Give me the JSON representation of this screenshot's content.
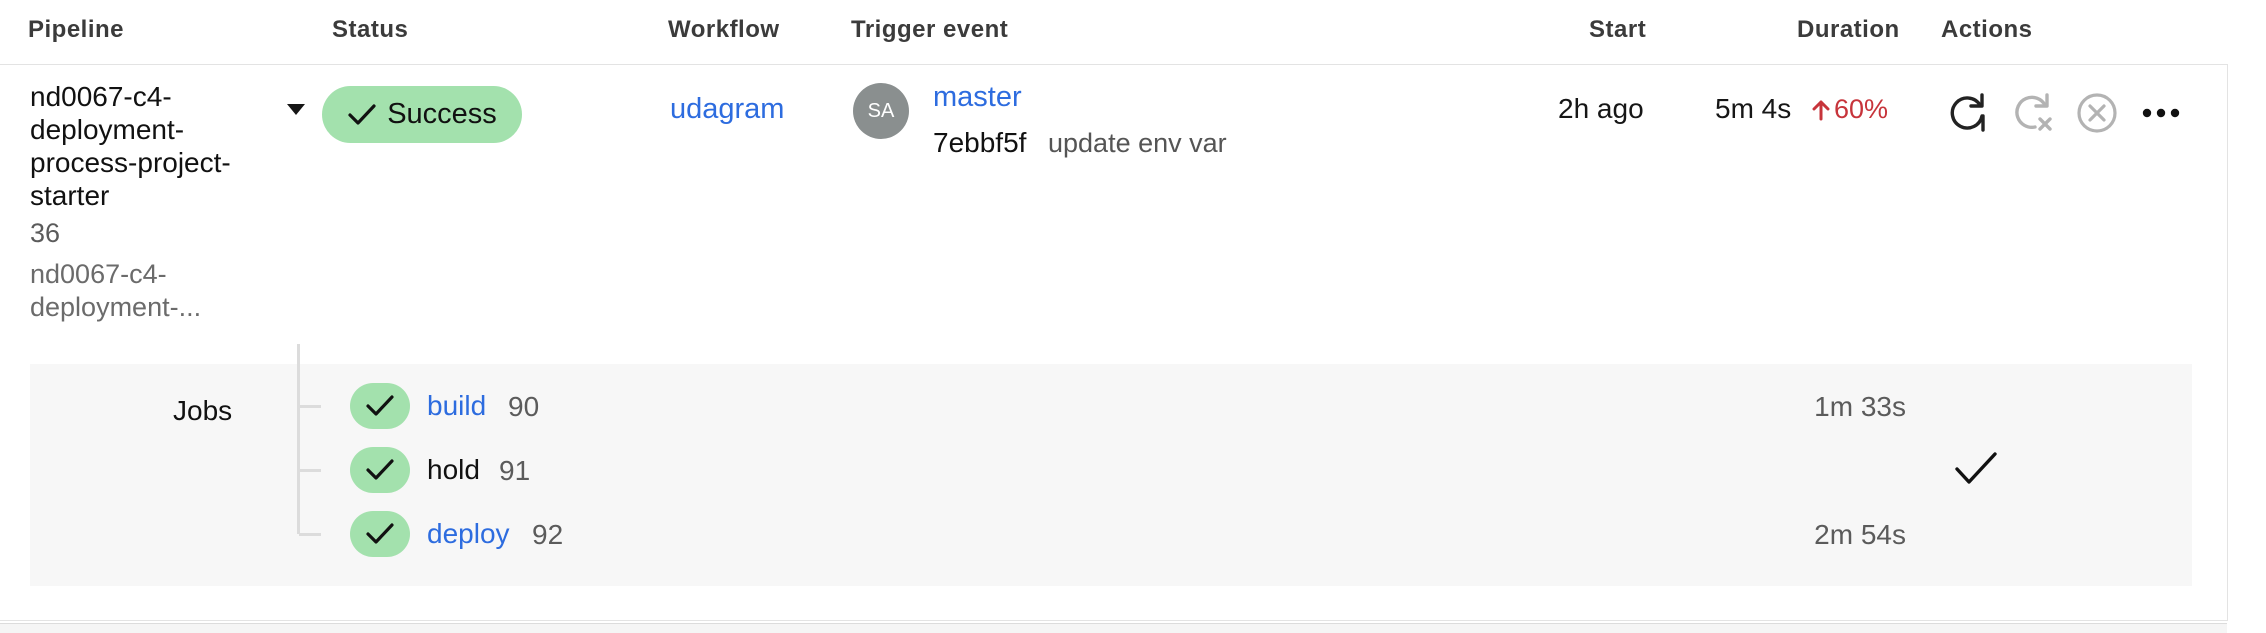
{
  "columns": {
    "pipeline": "Pipeline",
    "status": "Status",
    "workflow": "Workflow",
    "trigger": "Trigger event",
    "start": "Start",
    "duration": "Duration",
    "actions": "Actions"
  },
  "pipeline": {
    "name": "nd0067-c4-deployment-process-project-starter",
    "number": "36",
    "project": "nd0067-c4-deployment-..."
  },
  "status": {
    "label": "Success",
    "color": "#a3e1ad"
  },
  "workflow": "udagram",
  "trigger": {
    "avatar_initials": "SA",
    "branch": "master",
    "commit_hash": "7ebbf5f",
    "commit_message": "update env var"
  },
  "start": "2h ago",
  "duration": {
    "value": "5m 4s",
    "change": "60%",
    "change_direction": "up",
    "change_color": "#c7343b"
  },
  "actions": [
    "rerun-icon",
    "rerun-failed-icon",
    "cancel-icon",
    "more-icon"
  ],
  "jobs": {
    "label": "Jobs",
    "items": [
      {
        "name": "build",
        "number": "90",
        "duration": "1m 33s",
        "link": true
      },
      {
        "name": "hold",
        "number": "91",
        "duration": "",
        "approved": true,
        "link": false
      },
      {
        "name": "deploy",
        "number": "92",
        "duration": "2m 54s",
        "link": true
      }
    ]
  },
  "colors": {
    "link": "#2d6cdf",
    "success": "#a3e1ad",
    "error": "#c7343b"
  }
}
